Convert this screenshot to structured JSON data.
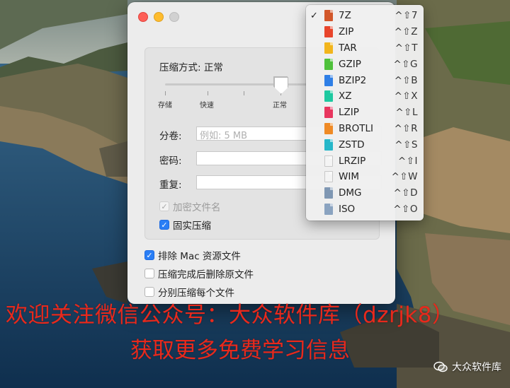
{
  "window": {
    "method_label": "压缩方式: 正常",
    "slider": {
      "ticks": [
        "存储",
        "快速",
        "正常"
      ],
      "level": "正常"
    },
    "split_label": "分卷:",
    "split_placeholder": "例如: 5 MB",
    "password_label": "密码:",
    "repeat_label": "重复:",
    "encrypt_names": {
      "label": "加密文件名",
      "checked": true,
      "disabled": true
    },
    "solid": {
      "label": "固实压缩",
      "checked": true
    },
    "exclude_mac": {
      "label": "排除 Mac 资源文件",
      "checked": true
    },
    "delete_after": {
      "label": "压缩完成后删除原文件",
      "checked": false
    },
    "separate": {
      "label": "分别压缩每个文件",
      "checked": false
    }
  },
  "menu": {
    "items": [
      {
        "name": "7Z",
        "shortcut": "^⇧7",
        "checked": true,
        "color": "#d2572a"
      },
      {
        "name": "ZIP",
        "shortcut": "^⇧Z",
        "checked": false,
        "color": "#e8452c"
      },
      {
        "name": "TAR",
        "shortcut": "^⇧T",
        "checked": false,
        "color": "#f2b51c"
      },
      {
        "name": "GZIP",
        "shortcut": "^⇧G",
        "checked": false,
        "color": "#4fc13b"
      },
      {
        "name": "BZIP2",
        "shortcut": "^⇧B",
        "checked": false,
        "color": "#2f7fe6"
      },
      {
        "name": "XZ",
        "shortcut": "^⇧X",
        "checked": false,
        "color": "#1ec9a0"
      },
      {
        "name": "LZIP",
        "shortcut": "^⇧L",
        "checked": false,
        "color": "#e8365e"
      },
      {
        "name": "BROTLI",
        "shortcut": "^⇧R",
        "checked": false,
        "color": "#ef8a25"
      },
      {
        "name": "ZSTD",
        "shortcut": "^⇧S",
        "checked": false,
        "color": "#26b7c9"
      },
      {
        "name": "LRZIP",
        "shortcut": "^⇧I",
        "checked": false,
        "color": "#f4f4f4"
      },
      {
        "name": "WIM",
        "shortcut": "^⇧W",
        "checked": false,
        "color": "#f4f4f4"
      },
      {
        "name": "DMG",
        "shortcut": "^⇧D",
        "checked": false,
        "color": "#7f97b3"
      },
      {
        "name": "ISO",
        "shortcut": "^⇧O",
        "checked": false,
        "color": "#8aa3c0"
      }
    ],
    "check_glyph": "✓"
  },
  "overlay": {
    "line1": "欢迎关注微信公众号：大众软件库（dzrjk8）",
    "line2": "获取更多免费学习信息",
    "watermark": "大众软件库"
  }
}
